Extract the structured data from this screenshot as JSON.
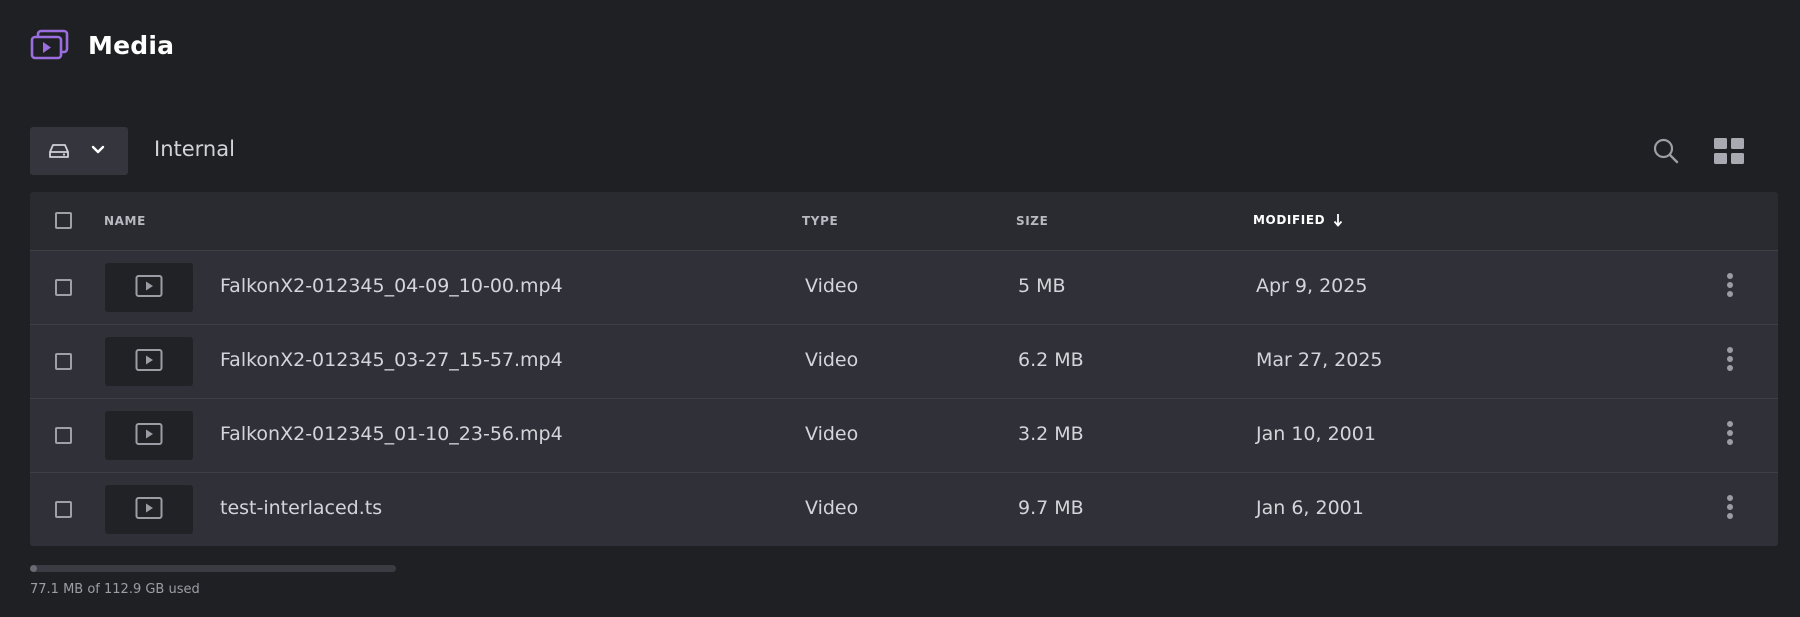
{
  "app": {
    "title": "Media",
    "icon": "media-library-icon",
    "accent_color": "#9b6ee0"
  },
  "toolbar": {
    "drive_icon": "drive-icon",
    "location": "Internal",
    "search_icon": "search-icon",
    "view_icon": "grid-view-icon"
  },
  "table": {
    "columns": {
      "name": "NAME",
      "type": "TYPE",
      "size": "SIZE",
      "modified": "MODIFIED"
    },
    "sort": {
      "column": "modified",
      "direction": "descending"
    },
    "rows": [
      {
        "name": "FalkonX2-012345_04-09_10-00.mp4",
        "type": "Video",
        "size": "5 MB",
        "modified": "Apr 9, 2025"
      },
      {
        "name": "FalkonX2-012345_03-27_15-57.mp4",
        "type": "Video",
        "size": "6.2 MB",
        "modified": "Mar 27, 2025"
      },
      {
        "name": "FalkonX2-012345_01-10_23-56.mp4",
        "type": "Video",
        "size": "3.2 MB",
        "modified": "Jan 10, 2001"
      },
      {
        "name": "test-interlaced.ts",
        "type": "Video",
        "size": "9.7 MB",
        "modified": "Jan 6, 2001"
      }
    ]
  },
  "storage": {
    "text": "77.1 MB of 112.9 GB used",
    "used_fraction": 0.02
  }
}
